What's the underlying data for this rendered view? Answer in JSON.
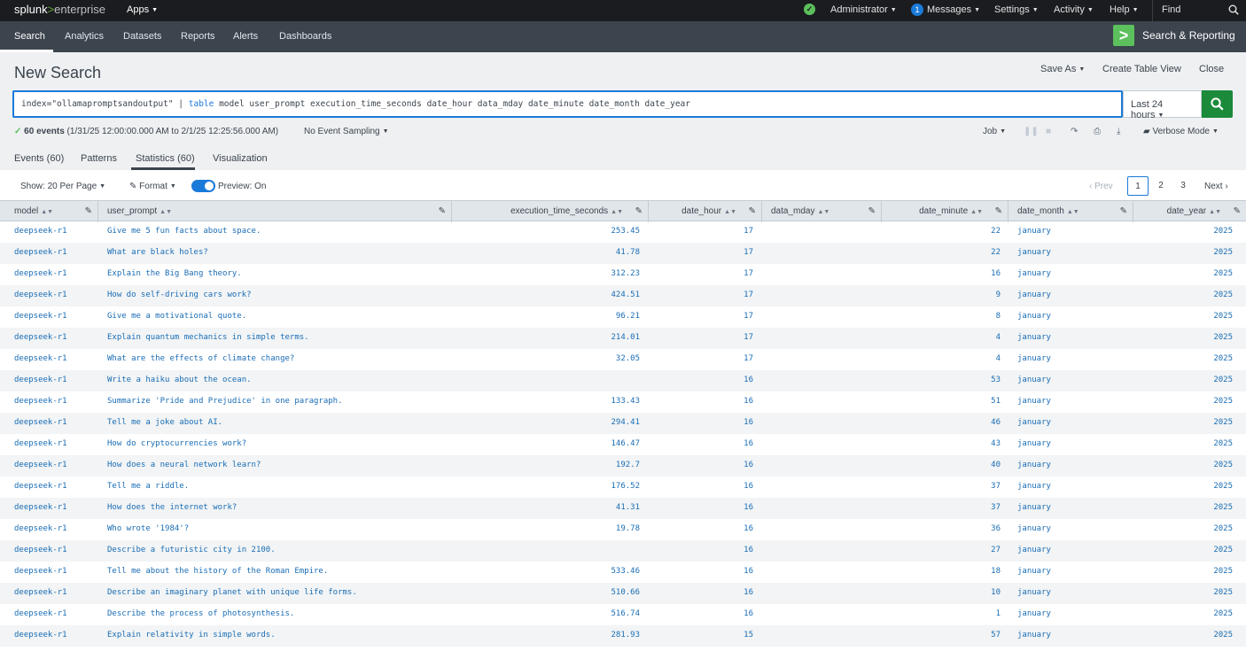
{
  "topbar": {
    "logo_splunk": "splunk",
    "logo_gt": ">",
    "logo_enterprise": "enterprise",
    "apps": "Apps",
    "administrator": "Administrator",
    "messages_count": "1",
    "messages": "Messages",
    "settings": "Settings",
    "activity": "Activity",
    "help": "Help",
    "find": "Find"
  },
  "appbar": {
    "nav": [
      "Search",
      "Analytics",
      "Datasets",
      "Reports",
      "Alerts",
      "Dashboards"
    ],
    "brand_glyph": ">",
    "brand": "Search & Reporting"
  },
  "header": {
    "title": "New Search",
    "save_as": "Save As",
    "create_table_view": "Create Table View",
    "close": "Close"
  },
  "search": {
    "query_prefix": "index=\"ollamapromptsandoutput\" | ",
    "query_keyword": "table",
    "query_suffix": " model user_prompt execution_time_seconds date_hour data_mday date_minute date_month date_year",
    "time_range": "Last 24 hours"
  },
  "status": {
    "check": "✓",
    "events_count": "60 events",
    "events_range": "(1/31/25 12:00:00.000 AM to 2/1/25 12:25:56.000 AM)",
    "sampling": "No Event Sampling",
    "job": "Job",
    "mode": "Verbose Mode"
  },
  "tabs": [
    "Events (60)",
    "Patterns",
    "Statistics (60)",
    "Visualization"
  ],
  "options": {
    "per_page": "Show: 20 Per Page",
    "format": "Format",
    "preview": "Preview: On",
    "prev": "Prev",
    "pages": [
      "1",
      "2",
      "3"
    ],
    "next": "Next"
  },
  "table": {
    "columns": [
      "model",
      "user_prompt",
      "execution_time_seconds",
      "date_hour",
      "data_mday",
      "date_minute",
      "date_month",
      "date_year"
    ],
    "rows": [
      [
        "deepseek-r1",
        "Give me 5 fun facts about space.",
        "253.45",
        "17",
        "",
        "22",
        "january",
        "2025"
      ],
      [
        "deepseek-r1",
        "What are black holes?",
        "41.78",
        "17",
        "",
        "22",
        "january",
        "2025"
      ],
      [
        "deepseek-r1",
        "Explain the Big Bang theory.",
        "312.23",
        "17",
        "",
        "16",
        "january",
        "2025"
      ],
      [
        "deepseek-r1",
        "How do self-driving cars work?",
        "424.51",
        "17",
        "",
        "9",
        "january",
        "2025"
      ],
      [
        "deepseek-r1",
        "Give me a motivational quote.",
        "96.21",
        "17",
        "",
        "8",
        "january",
        "2025"
      ],
      [
        "deepseek-r1",
        "Explain quantum mechanics in simple terms.",
        "214.01",
        "17",
        "",
        "4",
        "january",
        "2025"
      ],
      [
        "deepseek-r1",
        "What are the effects of climate change?",
        "32.05",
        "17",
        "",
        "4",
        "january",
        "2025"
      ],
      [
        "deepseek-r1",
        "Write a haiku about the ocean.",
        "",
        "16",
        "",
        "53",
        "january",
        "2025"
      ],
      [
        "deepseek-r1",
        "Summarize 'Pride and Prejudice' in one paragraph.",
        "133.43",
        "16",
        "",
        "51",
        "january",
        "2025"
      ],
      [
        "deepseek-r1",
        "Tell me a joke about AI.",
        "294.41",
        "16",
        "",
        "46",
        "january",
        "2025"
      ],
      [
        "deepseek-r1",
        "How do cryptocurrencies work?",
        "146.47",
        "16",
        "",
        "43",
        "january",
        "2025"
      ],
      [
        "deepseek-r1",
        "How does a neural network learn?",
        "192.7",
        "16",
        "",
        "40",
        "january",
        "2025"
      ],
      [
        "deepseek-r1",
        "Tell me a riddle.",
        "176.52",
        "16",
        "",
        "37",
        "january",
        "2025"
      ],
      [
        "deepseek-r1",
        "How does the internet work?",
        "41.31",
        "16",
        "",
        "37",
        "january",
        "2025"
      ],
      [
        "deepseek-r1",
        "Who wrote '1984'?",
        "19.78",
        "16",
        "",
        "36",
        "january",
        "2025"
      ],
      [
        "deepseek-r1",
        "Describe a futuristic city in 2100.",
        "",
        "16",
        "",
        "27",
        "january",
        "2025"
      ],
      [
        "deepseek-r1",
        "Tell me about the history of the Roman Empire.",
        "533.46",
        "16",
        "",
        "18",
        "january",
        "2025"
      ],
      [
        "deepseek-r1",
        "Describe an imaginary planet with unique life forms.",
        "510.66",
        "16",
        "",
        "10",
        "january",
        "2025"
      ],
      [
        "deepseek-r1",
        "Describe the process of photosynthesis.",
        "516.74",
        "16",
        "",
        "1",
        "january",
        "2025"
      ],
      [
        "deepseek-r1",
        "Explain relativity in simple words.",
        "281.93",
        "15",
        "",
        "57",
        "january",
        "2025"
      ]
    ]
  }
}
